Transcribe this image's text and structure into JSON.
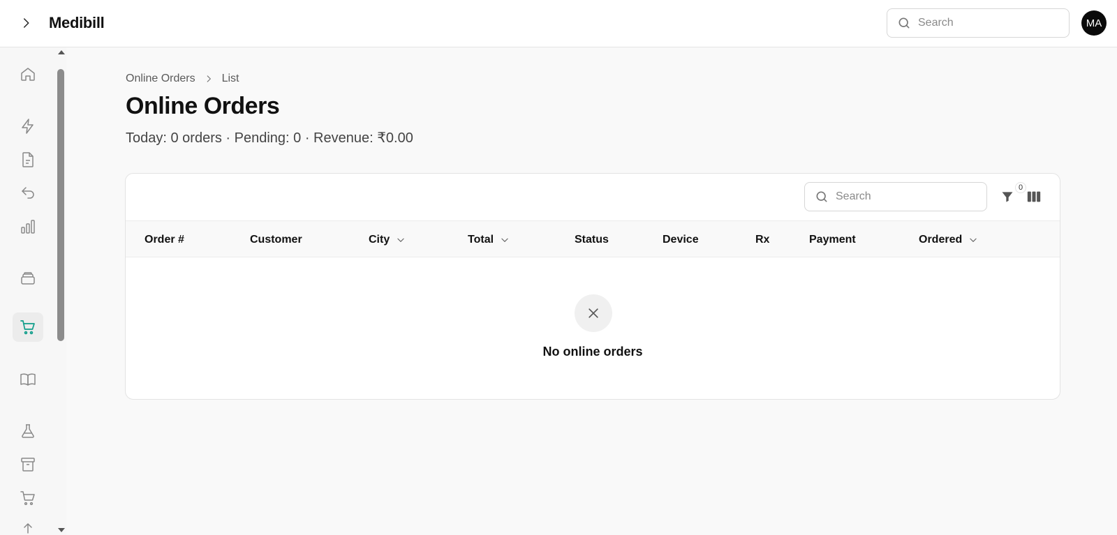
{
  "app": {
    "title": "Medibill"
  },
  "topbar": {
    "search_placeholder": "Search",
    "avatar_initials": "MA"
  },
  "sidebar": {
    "items": [
      {
        "icon": "home-icon"
      },
      {
        "icon": "lightning-icon"
      },
      {
        "icon": "document-icon"
      },
      {
        "icon": "return-icon"
      },
      {
        "icon": "bar-chart-icon"
      },
      {
        "icon": "layers-icon"
      },
      {
        "icon": "cart-icon",
        "active": true
      },
      {
        "icon": "book-icon"
      },
      {
        "icon": "flask-icon"
      },
      {
        "icon": "archive-icon"
      },
      {
        "icon": "cart-icon"
      },
      {
        "icon": "upload-icon"
      }
    ]
  },
  "breadcrumb": {
    "parent": "Online Orders",
    "current": "List"
  },
  "page": {
    "title": "Online Orders",
    "summary": "Today: 0 orders · Pending: 0 · Revenue: ₹0.00"
  },
  "table": {
    "search_placeholder": "Search",
    "filter_count": "0",
    "columns": [
      {
        "label": "Order #",
        "sortable": false
      },
      {
        "label": "Customer",
        "sortable": false
      },
      {
        "label": "City",
        "sortable": true
      },
      {
        "label": "Total",
        "sortable": true
      },
      {
        "label": "Status",
        "sortable": false
      },
      {
        "label": "Device",
        "sortable": false
      },
      {
        "label": "Rx",
        "sortable": false
      },
      {
        "label": "Payment",
        "sortable": false
      },
      {
        "label": "Ordered",
        "sortable": true
      }
    ],
    "rows": [],
    "empty_message": "No online orders"
  },
  "colors": {
    "accent": "#0f9d8a",
    "text": "#111111",
    "muted": "#5a5a5a"
  }
}
